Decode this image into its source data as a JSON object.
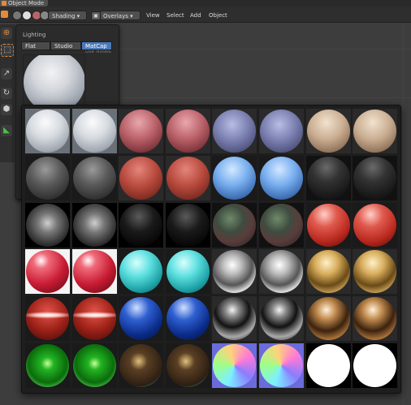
{
  "header": {
    "mode_label": "Object Mode",
    "shading_label": "Shading",
    "overlays_label": "Overlays",
    "menus": [
      "View",
      "Select",
      "Add",
      "Object"
    ]
  },
  "popover": {
    "title": "Lighting",
    "hint": "Use Nodes",
    "options": [
      {
        "label": "Flat",
        "active": false
      },
      {
        "label": "Studio",
        "active": false
      },
      {
        "label": "MatCap",
        "active": true
      }
    ]
  },
  "matcaps": [
    {
      "name": "ceramic-white",
      "bg": "#6a7078",
      "g": "radial-gradient(circle at 45% 30%,#fafbfc 0%,#d7dbe0 40%,#a0a7b0 75%,#3b4654 100%)"
    },
    {
      "name": "ceramic-white-2",
      "bg": "#6a7078",
      "g": "radial-gradient(circle at 45% 30%,#fafbfc 0%,#d7dbe0 40%,#a0a7b0 75%,#3b4654 100%)"
    },
    {
      "name": "pink-clay",
      "bg": "#2a2a2a",
      "g": "radial-gradient(circle at 45% 30%,#e9a7ad 0%,#b96068 45%,#7a3139 80%,#3a1418 100%)"
    },
    {
      "name": "pink-clay-2",
      "bg": "#2a2a2a",
      "g": "radial-gradient(circle at 45% 30%,#e9a7ad 0%,#b96068 45%,#7a3139 80%,#3a1418 100%)"
    },
    {
      "name": "lavender-soft",
      "bg": "#2a2a2a",
      "g": "radial-gradient(circle at 45% 35%,#b7bde3 0%,#7a7fb0 45%,#4c4f78 80%,#24253c 100%)"
    },
    {
      "name": "lavender-soft-2",
      "bg": "#2a2a2a",
      "g": "radial-gradient(circle at 45% 35%,#b7bde3 0%,#7a7fb0 45%,#4c4f78 80%,#24253c 100%)"
    },
    {
      "name": "skin-tan",
      "bg": "#2a2a2a",
      "g": "radial-gradient(circle at 45% 30%,#f1e2cf 0%,#c9ad91 45%,#8e6f55 80%,#3d2e22 100%)"
    },
    {
      "name": "skin-tan-2",
      "bg": "#2a2a2a",
      "g": "radial-gradient(circle at 45% 30%,#f1e2cf 0%,#c9ad91 45%,#8e6f55 80%,#3d2e22 100%)"
    },
    {
      "name": "dark-grey",
      "bg": "#1a1a1a",
      "g": "radial-gradient(circle at 45% 30%,#9a9a9a 0%,#5a5a5a 40%,#333 75%,#161616 100%)"
    },
    {
      "name": "dark-grey-2",
      "bg": "#1a1a1a",
      "g": "radial-gradient(circle at 45% 30%,#9a9a9a 0%,#5a5a5a 40%,#333 75%,#161616 100%)"
    },
    {
      "name": "red-clay",
      "bg": "#2a2a2a",
      "g": "radial-gradient(circle at 45% 30%,#e4857a 0%,#b84a3d 45%,#7c2a20 80%,#3a110c 100%)"
    },
    {
      "name": "red-clay-2",
      "bg": "#2a2a2a",
      "g": "radial-gradient(circle at 45% 30%,#e4857a 0%,#b84a3d 45%,#7c2a20 80%,#3a110c 100%)"
    },
    {
      "name": "sky-blue",
      "bg": "#1a1a1a",
      "g": "radial-gradient(circle at 45% 30%,#d3e8ff 0%,#7ab0f0 40%,#3e6fb4 75%,#16315c 100%)"
    },
    {
      "name": "sky-blue-2",
      "bg": "#1a1a1a",
      "g": "radial-gradient(circle at 45% 30%,#d3e8ff 0%,#7ab0f0 40%,#3e6fb4 75%,#16315c 100%)"
    },
    {
      "name": "black-plastic",
      "bg": "#111",
      "g": "radial-gradient(circle at 45% 25%,#6a6a6a 0%,#333 35%,#1a1a1a 70%,#0a0a0a 100%)"
    },
    {
      "name": "black-plastic-2",
      "bg": "#111",
      "g": "radial-gradient(circle at 45% 25%,#6a6a6a 0%,#333 35%,#1a1a1a 70%,#0a0a0a 100%)"
    },
    {
      "name": "rim-white",
      "bg": "#000",
      "g": "radial-gradient(circle at 50% 45%,#cfcfcf 0%,#777 30%,#2a2a2a 70%,#111 88%,#e8e8e8 92%,#111 100%)"
    },
    {
      "name": "rim-white-2",
      "bg": "#000",
      "g": "radial-gradient(circle at 50% 45%,#cfcfcf 0%,#777 30%,#2a2a2a 70%,#111 88%,#e8e8e8 92%,#111 100%)"
    },
    {
      "name": "black-rim",
      "bg": "#000",
      "g": "radial-gradient(circle at 45% 30%,#5a5a5a 0%,#1a1a1a 40%,#050505 80%,#cfcfcf 93%,#000 100%)"
    },
    {
      "name": "black-rim-2",
      "bg": "#000",
      "g": "radial-gradient(circle at 45% 30%,#5a5a5a 0%,#1a1a1a 40%,#050505 80%,#cfcfcf 93%,#000 100%)"
    },
    {
      "name": "toon-dark",
      "bg": "#111",
      "g": "radial-gradient(circle at 40% 35%,#6e8a6a 0%,#3f4c40 35%,#5a3c3c 60%,#1f1f1f 100%)"
    },
    {
      "name": "toon-dark-2",
      "bg": "#111",
      "g": "radial-gradient(circle at 40% 35%,#6e8a6a 0%,#3f4c40 35%,#5a3c3c 60%,#1f1f1f 100%)"
    },
    {
      "name": "shiny-red",
      "bg": "#1a1a1a",
      "g": "radial-gradient(circle at 40% 25%,#ffd0c8 0%,#e05a4e 30%,#b8281e 65%,#4a0a06 100%)"
    },
    {
      "name": "shiny-red-2",
      "bg": "#1a1a1a",
      "g": "radial-gradient(circle at 40% 25%,#ffd0c8 0%,#e05a4e 30%,#b8281e 65%,#4a0a06 100%)"
    },
    {
      "name": "candy-red",
      "bg": "#f4f4f4",
      "g": "radial-gradient(circle at 35% 25%,#ffffff 0%,#f06b7a 18%,#c81c33 55%,#5a0613 100%)"
    },
    {
      "name": "candy-red-2",
      "bg": "#f4f4f4",
      "g": "radial-gradient(circle at 35% 25%,#ffffff 0%,#f06b7a 18%,#c81c33 55%,#5a0613 100%)"
    },
    {
      "name": "cyan-gloss",
      "bg": "#1a1a1a",
      "g": "radial-gradient(circle at 40% 30%,#d8fffd 0%,#5ee0e0 35%,#1b9ea3 70%,#0a4b50 100%)"
    },
    {
      "name": "cyan-gloss-2",
      "bg": "#1a1a1a",
      "g": "radial-gradient(circle at 40% 30%,#d8fffd 0%,#5ee0e0 35%,#1b9ea3 70%,#0a4b50 100%)"
    },
    {
      "name": "chrome",
      "bg": "#2a2a2a",
      "g": "radial-gradient(circle at 45% 35%,#ffffff 0%,#bdbdbd 25%,#555 55%,#e0e0e0 75%,#222 100%)"
    },
    {
      "name": "chrome-2",
      "bg": "#2a2a2a",
      "g": "radial-gradient(circle at 45% 35%,#ffffff 0%,#bdbdbd 25%,#555 55%,#e0e0e0 75%,#222 100%)"
    },
    {
      "name": "gold",
      "bg": "#2a2a2a",
      "g": "radial-gradient(circle at 45% 30%,#fff0c8 0%,#d7ad5c 30%,#6a4a16 60%,#caa25a 80%,#2a1a05 100%)"
    },
    {
      "name": "gold-2",
      "bg": "#2a2a2a",
      "g": "radial-gradient(circle at 45% 30%,#fff0c8 0%,#d7ad5c 30%,#6a4a16 60%,#caa25a 80%,#2a1a05 100%)"
    },
    {
      "name": "red-stripe",
      "bg": "#1a1a1a",
      "g": "radial-gradient(ellipse 60% 8% at 50% 42%,#ffffff 0%,#ffd6d0 40%,rgba(0,0,0,0) 100%),radial-gradient(circle at 50% 35%,#e4554a 0%,#a0231a 50%,#400805 100%)"
    },
    {
      "name": "red-stripe-2",
      "bg": "#1a1a1a",
      "g": "radial-gradient(ellipse 60% 8% at 50% 42%,#ffffff 0%,#ffd6d0 40%,rgba(0,0,0,0) 100%),radial-gradient(circle at 50% 35%,#e4554a 0%,#a0231a 50%,#400805 100%)"
    },
    {
      "name": "deep-blue",
      "bg": "#1a1a1a",
      "g": "radial-gradient(circle at 40% 25%,#cfe0ff 0%,#2f5fd0 30%,#0b2d8a 65%,#020c30 100%)"
    },
    {
      "name": "deep-blue-2",
      "bg": "#1a1a1a",
      "g": "radial-gradient(circle at 40% 25%,#cfe0ff 0%,#2f5fd0 30%,#0b2d8a 65%,#020c30 100%)"
    },
    {
      "name": "black-chrome",
      "bg": "#2a2a2a",
      "g": "radial-gradient(circle at 45% 30%,#f4f4f4 0%,#888 18%,#111 45%,#a8a8a8 70%,#0a0a0a 100%)"
    },
    {
      "name": "black-chrome-2",
      "bg": "#2a2a2a",
      "g": "radial-gradient(circle at 45% 30%,#f4f4f4 0%,#888 18%,#111 45%,#a8a8a8 70%,#0a0a0a 100%)"
    },
    {
      "name": "bronze",
      "bg": "#2a2a2a",
      "g": "radial-gradient(circle at 45% 30%,#fff1d8 0%,#c08a4e 25%,#3c220e 55%,#b0773c 78%,#1f1005 100%)"
    },
    {
      "name": "bronze-2",
      "bg": "#2a2a2a",
      "g": "radial-gradient(circle at 45% 30%,#fff1d8 0%,#c08a4e 25%,#3c220e 55%,#b0773c 78%,#1f1005 100%)"
    },
    {
      "name": "green-glow",
      "bg": "#1a1a1a",
      "g": "radial-gradient(circle at 50% 45%,#c8ff9a 0%,#22b422 20%,#0b6b0b 60%,#63e063 88%,#0a2a0a 100%)"
    },
    {
      "name": "green-glow-2",
      "bg": "#1a1a1a",
      "g": "radial-gradient(circle at 50% 45%,#c8ff9a 0%,#22b422 20%,#0b6b0b 60%,#63e063 88%,#0a2a0a 100%)"
    },
    {
      "name": "brown-rim",
      "bg": "#1a1a1a",
      "g": "radial-gradient(circle at 45% 40%,#e0c27a 0%,#5a3f24 25%,#2c1e12 70%,#6ed6e0 92%,#0d1a1c 100%)"
    },
    {
      "name": "brown-rim-2",
      "bg": "#1a1a1a",
      "g": "radial-gradient(circle at 45% 40%,#e0c27a 0%,#5a3f24 25%,#2c1e12 70%,#6ed6e0 92%,#0d1a1c 100%)"
    },
    {
      "name": "normal-map",
      "bg": "#6b6bdc",
      "g": "conic-gradient(from 200deg at 50% 50%,#7cf0ff,#9cff8a,#ffd27a,#ff7ad6,#8a7cff,#7cf0ff)"
    },
    {
      "name": "normal-map-2",
      "bg": "#6b6bdc",
      "g": "conic-gradient(from 200deg at 50% 50%,#7cf0ff,#9cff8a,#ffd27a,#ff7ad6,#8a7cff,#7cf0ff)"
    },
    {
      "name": "flat-white",
      "bg": "#000",
      "g": "radial-gradient(circle,#ffffff 0%,#ffffff 100%)"
    },
    {
      "name": "flat-white-2",
      "bg": "#000",
      "g": "radial-gradient(circle,#ffffff 0%,#ffffff 100%)"
    }
  ]
}
